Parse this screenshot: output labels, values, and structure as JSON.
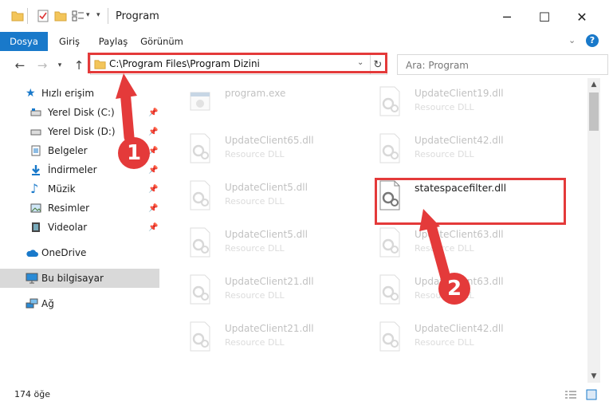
{
  "window": {
    "title": "Program",
    "minimize_glyph": "─",
    "maximize_glyph": "☐",
    "close_glyph": "✕"
  },
  "ribbon": {
    "tabs": [
      {
        "label": "Dosya",
        "active": true
      },
      {
        "label": "Giriş"
      },
      {
        "label": "Paylaş"
      },
      {
        "label": "Görünüm"
      }
    ]
  },
  "address": {
    "path": "C:\\Program Files\\Program Dizini",
    "search_placeholder": "Ara: Program"
  },
  "nav": {
    "quick_access": "Hızlı erişim",
    "items": [
      {
        "label": "Yerel Disk (C:)",
        "icon": "drive-icon"
      },
      {
        "label": "Yerel Disk (D:)",
        "icon": "drive-icon"
      },
      {
        "label": "Belgeler",
        "icon": "document-icon"
      },
      {
        "label": "İndirmeler",
        "icon": "download-icon"
      },
      {
        "label": "Müzik",
        "icon": "music-icon"
      },
      {
        "label": "Resimler",
        "icon": "pictures-icon"
      },
      {
        "label": "Videolar",
        "icon": "video-icon"
      }
    ],
    "onedrive": "OneDrive",
    "this_pc": "Bu bilgisayar",
    "network": "Ağ"
  },
  "files": {
    "left": [
      {
        "name": "program.exe",
        "type": ""
      },
      {
        "name": "UpdateClient65.dll",
        "type": "Resource DLL"
      },
      {
        "name": "UpdateClient5.dll",
        "type": "Resource DLL"
      },
      {
        "name": "UpdateClient5.dll",
        "type": "Resource DLL"
      },
      {
        "name": "UpdateClient21.dll",
        "type": "Resource DLL"
      },
      {
        "name": "UpdateClient21.dll",
        "type": "Resource DLL"
      }
    ],
    "right": [
      {
        "name": "UpdateClient19.dll",
        "type": "Resource DLL"
      },
      {
        "name": "UpdateClient42.dll",
        "type": "Resource DLL"
      },
      {
        "name": "statespacefilter.dll",
        "type": ""
      },
      {
        "name": "UpdateClient63.dll",
        "type": "Resource DLL"
      },
      {
        "name": "UpdateClient63.dll",
        "type": "Resource DLL"
      },
      {
        "name": "UpdateClient42.dll",
        "type": "Resource DLL"
      }
    ]
  },
  "status": {
    "count": "174 öğe"
  },
  "annotations": {
    "step1": "1",
    "step2": "2",
    "color": "#e43a3a"
  },
  "colors": {
    "accent": "#1979ca",
    "selection": "#d9d9d9"
  }
}
